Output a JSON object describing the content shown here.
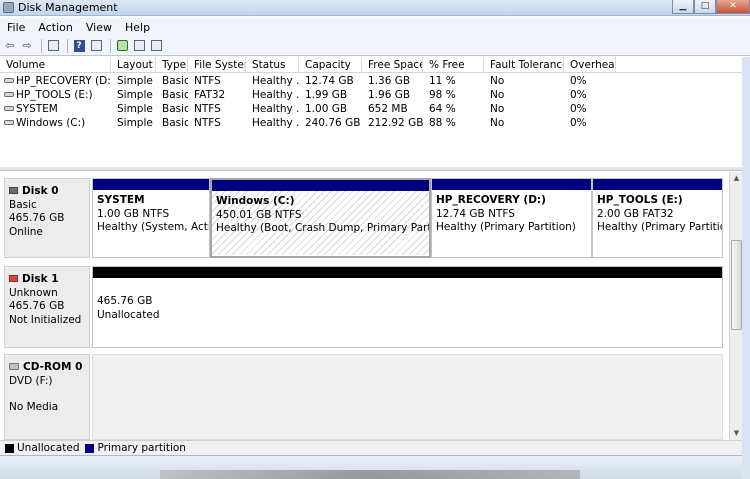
{
  "window": {
    "title": "Disk Management"
  },
  "menu": [
    "File",
    "Action",
    "View",
    "Help"
  ],
  "toolbar": {
    "icons": [
      "back-arrow-icon",
      "forward-arrow-icon",
      "console-tree-icon",
      "help-icon",
      "properties-icon",
      "refresh-icon",
      "rescan-icon",
      "settings-icon"
    ]
  },
  "columns": [
    "Volume",
    "Layout",
    "Type",
    "File System",
    "Status",
    "Capacity",
    "Free Space",
    "% Free",
    "Fault Tolerance",
    "Overhead"
  ],
  "volumes": [
    {
      "volume": "HP_RECOVERY (D:)",
      "layout": "Simple",
      "type": "Basic",
      "fs": "NTFS",
      "status": "Healthy ...",
      "capacity": "12.74 GB",
      "free": "1.36 GB",
      "pct": "11 %",
      "fault": "No",
      "overhead": "0%"
    },
    {
      "volume": "HP_TOOLS (E:)",
      "layout": "Simple",
      "type": "Basic",
      "fs": "FAT32",
      "status": "Healthy ...",
      "capacity": "1.99 GB",
      "free": "1.96 GB",
      "pct": "98 %",
      "fault": "No",
      "overhead": "0%"
    },
    {
      "volume": "SYSTEM",
      "layout": "Simple",
      "type": "Basic",
      "fs": "NTFS",
      "status": "Healthy ...",
      "capacity": "1.00 GB",
      "free": "652 MB",
      "pct": "64 %",
      "fault": "No",
      "overhead": "0%"
    },
    {
      "volume": "Windows (C:)",
      "layout": "Simple",
      "type": "Basic",
      "fs": "NTFS",
      "status": "Healthy ...",
      "capacity": "240.76 GB",
      "free": "212.92 GB",
      "pct": "88 %",
      "fault": "No",
      "overhead": "0%"
    }
  ],
  "disks": [
    {
      "name": "Disk 0",
      "kind": "Basic",
      "size": "465.76 GB",
      "state": "Online",
      "partitions": [
        {
          "name": "SYSTEM",
          "size": "1.00 GB NTFS",
          "status": "Healthy (System, Active,"
        },
        {
          "name": "Windows  (C:)",
          "size": "450.01 GB NTFS",
          "status": "Healthy (Boot, Crash Dump, Primary Partition)"
        },
        {
          "name": "HP_RECOVERY  (D:)",
          "size": "12.74 GB NTFS",
          "status": "Healthy (Primary Partition)"
        },
        {
          "name": "HP_TOOLS  (E:)",
          "size": "2.00 GB FAT32",
          "status": "Healthy (Primary Partition)"
        }
      ]
    },
    {
      "name": "Disk 1",
      "kind": "Unknown",
      "size": "465.76 GB",
      "state": "Not Initialized",
      "partitions": [
        {
          "size": "465.76 GB",
          "status": "Unallocated"
        }
      ]
    },
    {
      "name": "CD-ROM 0",
      "kind": "DVD (F:)",
      "state": "No Media"
    }
  ],
  "legend": {
    "unallocated": "Unallocated",
    "primary": "Primary partition"
  },
  "colors": {
    "primary_partition": "#00007f",
    "unallocated": "#000000",
    "titlebar": "#c3d5ea"
  }
}
